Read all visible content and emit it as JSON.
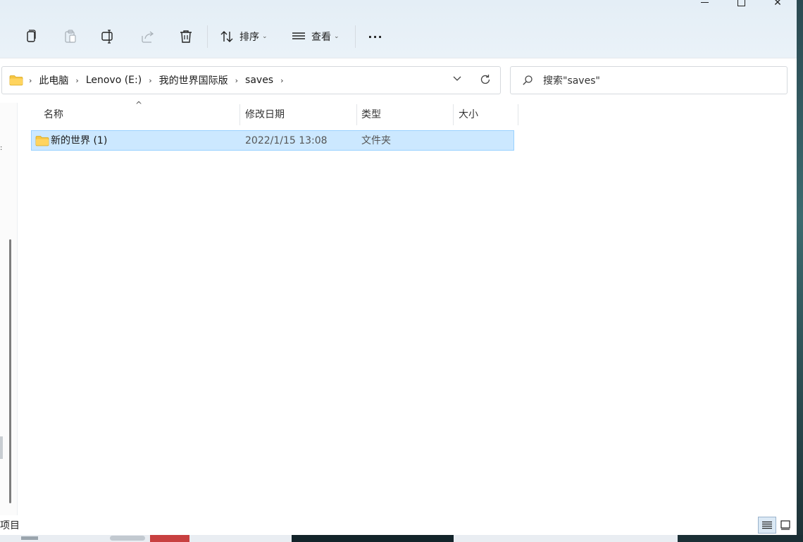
{
  "window": {
    "minimize_glyph": "—",
    "close_glyph": "✕"
  },
  "toolbar": {
    "sort_label": "排序",
    "view_label": "查看",
    "more_label": "···"
  },
  "address": {
    "crumbs": [
      "此电脑",
      "Lenovo (E:)",
      "我的世界国际版",
      "saves"
    ],
    "separator": "›"
  },
  "search": {
    "placeholder": "搜索\"saves\""
  },
  "columns": {
    "name": "名称",
    "modified": "修改日期",
    "type": "类型",
    "size": "大小",
    "sort_glyph": "^"
  },
  "rows": [
    {
      "name": "新的世界 (1)",
      "modified": "2022/1/15 13:08",
      "type": "文件夹",
      "size": ""
    }
  ],
  "status": {
    "text": "项目"
  },
  "colors": {
    "selection_bg": "#cce8ff",
    "selection_border": "#99d1ff",
    "folder_yellow": "#f5c542"
  }
}
